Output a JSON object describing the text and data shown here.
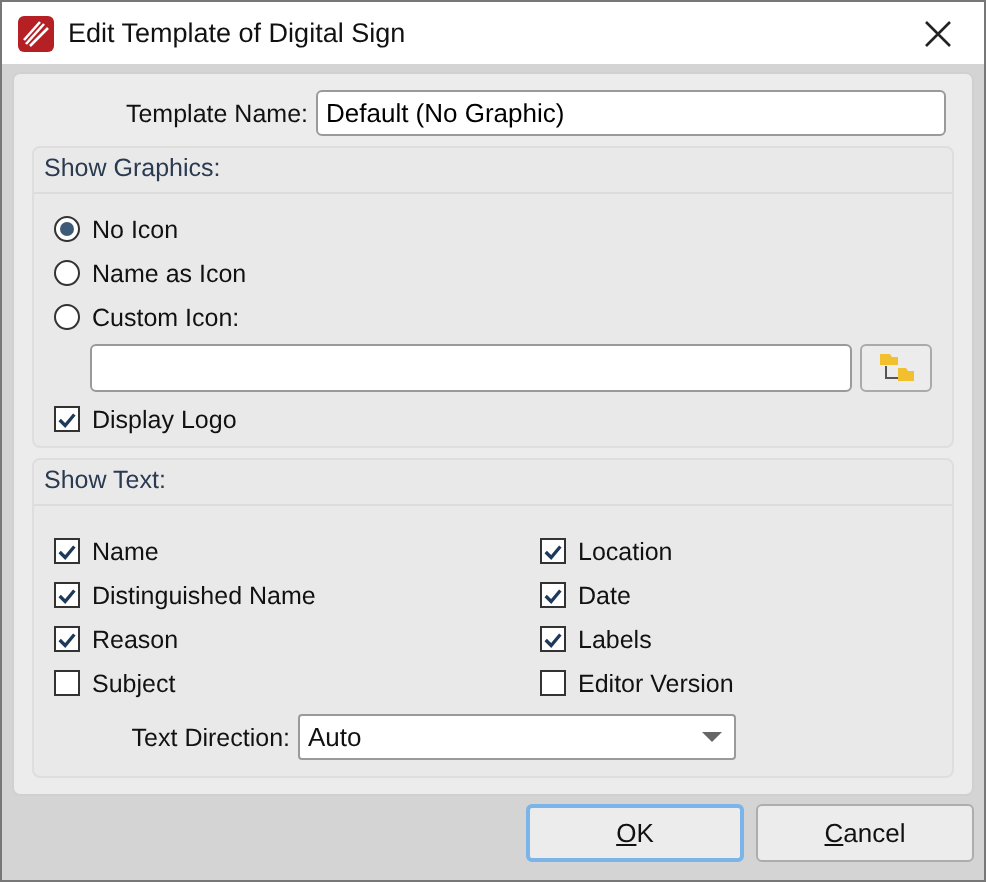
{
  "window": {
    "title": "Edit Template of Digital Sign"
  },
  "template_name": {
    "label": "Template Name:",
    "value": "Default (No Graphic)"
  },
  "show_graphics": {
    "title": "Show Graphics:",
    "options": [
      {
        "label": "No Icon",
        "selected": true
      },
      {
        "label": "Name as Icon",
        "selected": false
      },
      {
        "label": "Custom Icon:",
        "selected": false
      }
    ],
    "display_logo": {
      "label": "Display Logo",
      "checked": true
    }
  },
  "show_text": {
    "title": "Show Text:",
    "items": [
      {
        "label": "Name",
        "checked": true
      },
      {
        "label": "Location",
        "checked": true
      },
      {
        "label": "Distinguished Name",
        "checked": true
      },
      {
        "label": "Date",
        "checked": true
      },
      {
        "label": "Reason",
        "checked": true
      },
      {
        "label": "Labels",
        "checked": true
      },
      {
        "label": "Subject",
        "checked": false
      },
      {
        "label": "Editor Version",
        "checked": false
      }
    ],
    "text_direction": {
      "label": "Text Direction:",
      "value": "Auto"
    }
  },
  "buttons": [
    {
      "mnemonic": "O",
      "rest": "K",
      "default": true
    },
    {
      "mnemonic": "C",
      "rest": "ancel",
      "default": false
    }
  ]
}
